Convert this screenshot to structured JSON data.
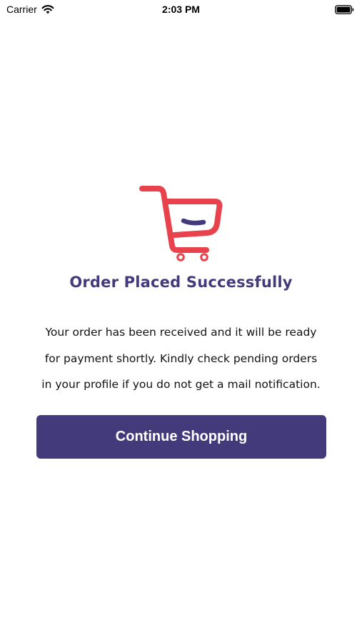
{
  "status_bar": {
    "carrier": "Carrier",
    "time": "2:03 PM",
    "icons": [
      "wifi-icon",
      "battery-icon"
    ]
  },
  "success": {
    "illustration": "shopping-cart-smile-icon",
    "title": "Order Placed Successfully",
    "message_lines": [
      "Your order has been received and it will be ready",
      "for payment shortly.  Kindly check pending orders",
      "in your profile if you do not get a mail notification."
    ]
  },
  "actions": {
    "continue_label": "Continue Shopping"
  },
  "colors": {
    "primary": "#433a7c",
    "cart_red": "#e8434d",
    "background": "#ffffff",
    "button_text": "#ffffff"
  }
}
